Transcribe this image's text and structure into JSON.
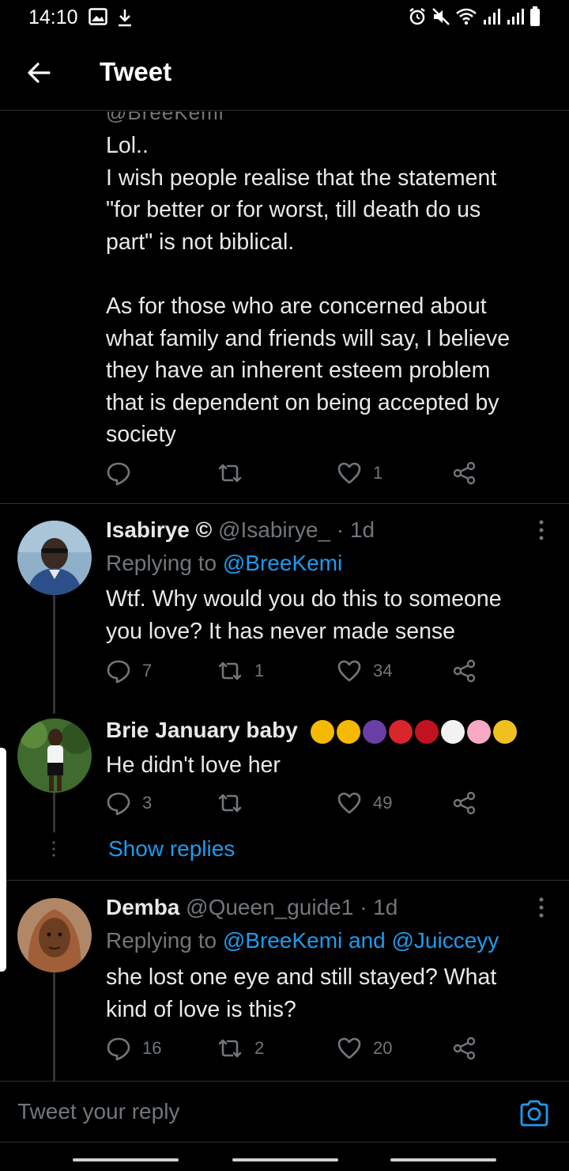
{
  "status_bar": {
    "time": "14:10",
    "left_icons": [
      "image-icon",
      "download-icon"
    ],
    "right_icons": [
      "alarm-icon",
      "mute-icon",
      "wifi-icon",
      "signal-icon",
      "signal-icon",
      "battery-icon"
    ]
  },
  "header": {
    "title": "Tweet"
  },
  "cut_handle": "@BreeKemi",
  "main_tweet": {
    "lines": [
      "Lol..",
      "I wish people realise that the statement",
      "\"for better or for worst, till death do us",
      "part\" is not biblical.",
      "",
      "As for those who are concerned about",
      "what family and friends will say, I believe",
      "they have an inherent esteem problem",
      "that is dependent on being accepted by",
      "society"
    ],
    "replies": "",
    "retweets": "",
    "likes": "1"
  },
  "replies": [
    {
      "name": "Isabirye ©",
      "handle": "@Isabirye_ · 1d",
      "replying_prefix": "Replying to ",
      "replying_to": "@BreeKemi",
      "lines": [
        "Wtf. Why would you do this to someone",
        "you love? It has never made sense"
      ],
      "replies": "7",
      "retweets": "1",
      "likes": "34"
    },
    {
      "name": "Brie January baby",
      "handle": "",
      "lines": [
        "He didn't love her"
      ],
      "replies": "3",
      "retweets": "",
      "likes": "49"
    },
    {
      "name": "Demba",
      "handle": "@Queen_guide1 · 1d",
      "replying_prefix": "Replying to ",
      "replying_to": "@BreeKemi and @Juicceyy",
      "lines": [
        "she lost one eye and still stayed? What",
        "kind of love is this?"
      ],
      "replies": "16",
      "retweets": "2",
      "likes": "20"
    }
  ],
  "show_replies": "Show replies",
  "compose": {
    "placeholder": "Tweet your reply"
  },
  "colors": {
    "background": "#000000",
    "text": "#e7e9ea",
    "muted": "#71767b",
    "link": "#1d9bf0",
    "divider": "#2f3336"
  }
}
